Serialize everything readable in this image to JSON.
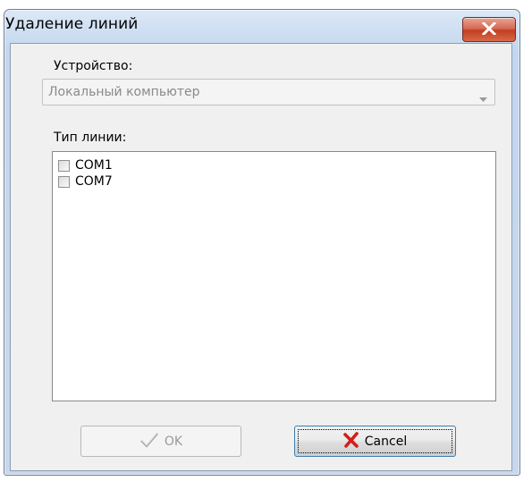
{
  "window": {
    "title": "Удаление линий",
    "close_icon": "close-x-icon"
  },
  "device": {
    "label": "Устройство:",
    "value": "Локальный компьютер",
    "arrow_icon": "chevron-down-icon"
  },
  "line_type": {
    "label": "Тип линии:",
    "items": [
      {
        "label": "COM1",
        "checked": false
      },
      {
        "label": "COM7",
        "checked": false
      }
    ]
  },
  "buttons": {
    "ok": {
      "label": "OK",
      "icon": "checkmark-icon",
      "enabled": false
    },
    "cancel": {
      "label": "Cancel",
      "icon": "red-x-icon"
    }
  },
  "colors": {
    "close_button": "#c23f23",
    "cancel_icon": "#d21e17",
    "focus_border": "#3c7fb1"
  }
}
